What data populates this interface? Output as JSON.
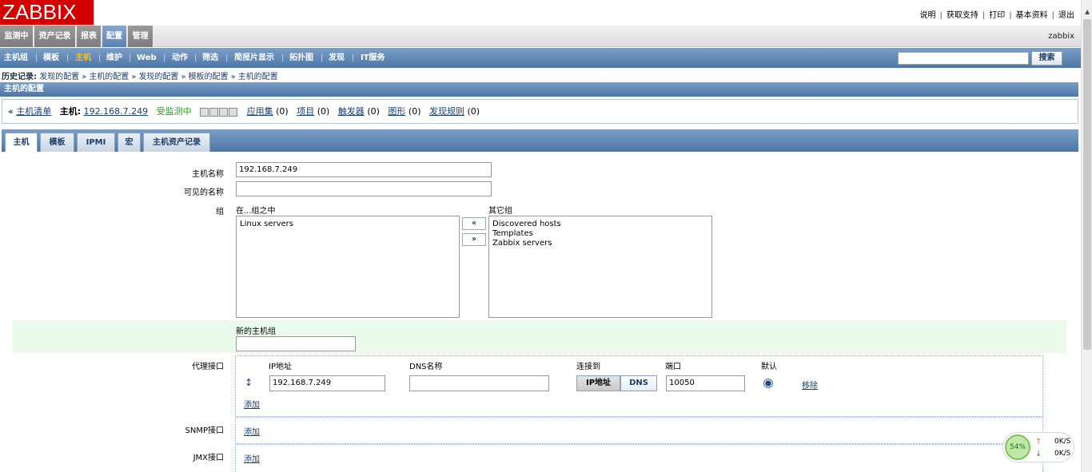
{
  "logo": {
    "text": "ZABBIX"
  },
  "top_links": [
    "说明",
    "获取支持",
    "打印",
    "基本资料",
    "退出"
  ],
  "main_menu": [
    {
      "label": "监测中"
    },
    {
      "label": "资产记录"
    },
    {
      "label": "报表"
    },
    {
      "label": "配置",
      "active": true
    },
    {
      "label": "管理"
    }
  ],
  "user": {
    "name": "zabbix"
  },
  "sub_menu": [
    {
      "label": "主机组"
    },
    {
      "label": "模板"
    },
    {
      "label": "主机",
      "active": true
    },
    {
      "label": "维护"
    },
    {
      "label": "Web"
    },
    {
      "label": "动作"
    },
    {
      "label": "筛选"
    },
    {
      "label": "简报片显示"
    },
    {
      "label": "拓扑图"
    },
    {
      "label": "发现"
    },
    {
      "label": "IT服务"
    }
  ],
  "search": {
    "button": "搜索",
    "value": ""
  },
  "history": {
    "label": "历史记录:",
    "items": [
      "发现的配置",
      "主机的配置",
      "发现的配置",
      "模板的配置",
      "主机的配置"
    ]
  },
  "section": {
    "title": "主机的配置"
  },
  "host_nav": {
    "host_list": "主机清单",
    "host_label": "主机:",
    "host_name": "192.168.7.249",
    "status": "受监测中",
    "applications": "应用集",
    "applications_count": "(0)",
    "items": "项目",
    "items_count": "(0)",
    "triggers": "触发器",
    "triggers_count": "(0)",
    "graphs": "图形",
    "graphs_count": "(0)",
    "discovery": "发现规则",
    "discovery_count": "(0)"
  },
  "tabs": [
    {
      "label": "主机",
      "active": true
    },
    {
      "label": "模板"
    },
    {
      "label": "IPMI"
    },
    {
      "label": "宏"
    },
    {
      "label": "主机资产记录"
    }
  ],
  "form": {
    "host_name_label": "主机名称",
    "host_name_value": "192.168.7.249",
    "visible_name_label": "可见的名称",
    "visible_name_value": "",
    "groups_label": "组",
    "in_groups_label": "在...组之中",
    "in_groups": [
      "Linux servers"
    ],
    "other_groups_label": "其它组",
    "other_groups": [
      "Discovered hosts",
      "Templates",
      "Zabbix servers"
    ],
    "move_left": "«",
    "move_right": "»",
    "new_group_label": "新的主机组",
    "new_group_value": "",
    "agent_interfaces_label": "代理接口",
    "ip_col": "IP地址",
    "dns_col": "DNS名称",
    "connect_col": "连接到",
    "port_col": "端口",
    "default_col": "默认",
    "ip_value": "192.168.7.249",
    "dns_value": "",
    "connect_ip": "IP地址",
    "connect_dns": "DNS",
    "port_value": "10050",
    "remove": "移除",
    "add": "添加",
    "snmp_label": "SNMP接口",
    "jmx_label": "JMX接口"
  },
  "net_widget": {
    "percent": "54%",
    "up": "0K/S",
    "down": "0K/S"
  }
}
